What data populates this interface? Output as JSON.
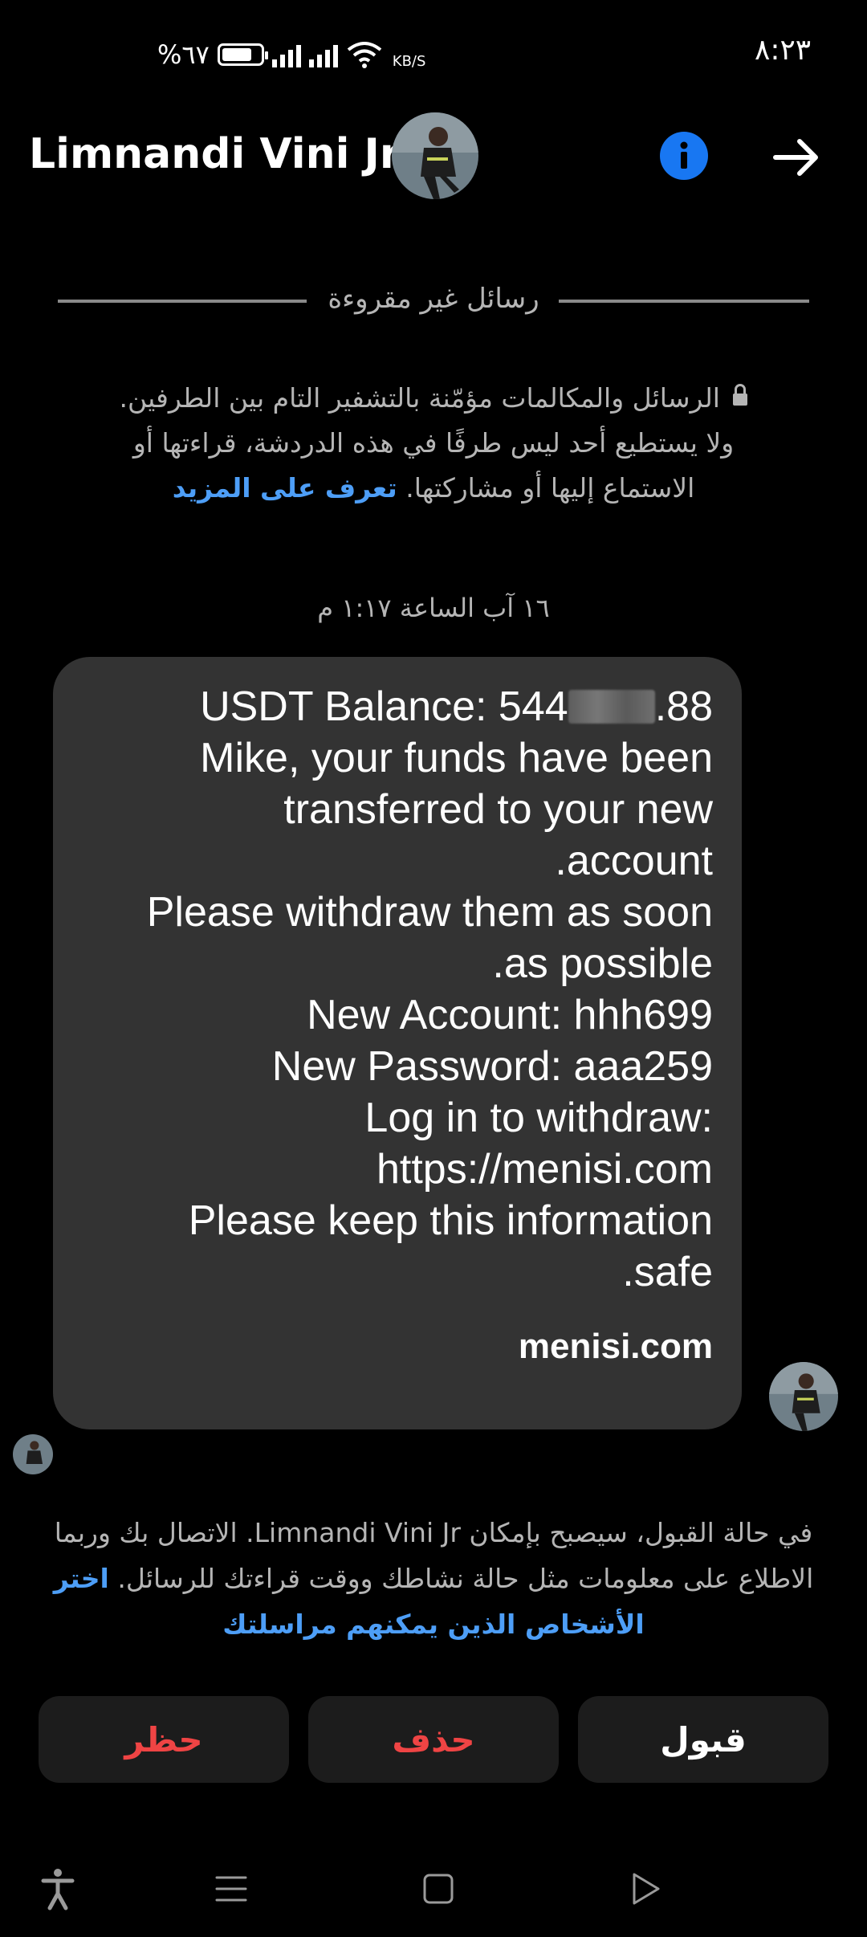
{
  "status_bar": {
    "time": "٨:٢٣",
    "battery": "%٦٧",
    "net_speed": "KB/S"
  },
  "header": {
    "title": "Limnandi Vini Jr.",
    "avatar_icon": "profile-avatar",
    "info_icon": "info-icon",
    "back_icon": "arrow-right-icon"
  },
  "divider": {
    "label": "رسائل غير مقروءة"
  },
  "notice": {
    "text": "الرسائل والمكالمات مؤمّنة بالتشفير التام بين الطرفين. ولا يستطيع أحد ليس طرفًا في هذه الدردشة، قراءتها أو الاستماع إليها أو مشاركتها.",
    "link": "تعرف على المزيد"
  },
  "timestamp": "١٦ آب الساعة ١:١٧ م",
  "message": {
    "balance_prefix": "USDT Balance: 544",
    "balance_suffix": ".88",
    "lines": [
      "Mike, your funds have been",
      "transferred to your new",
      ".account",
      "Please withdraw them as soon",
      ".as possible",
      "New Account: hhh699",
      "New Password: aaa259",
      "Log in to withdraw:",
      "https://menisi.com",
      "Please keep this information",
      ".safe"
    ],
    "link_preview": "menisi.com"
  },
  "request_note": {
    "text": "في حالة القبول، سيصبح بإمكان Limnandi Vini Jr. الاتصال بك وربما الاطلاع على معلومات مثل حالة نشاطك ووقت قراءتك للرسائل.",
    "link": "اختر الأشخاص الذين يمكنهم مراسلتك"
  },
  "actions": {
    "block": "حظر",
    "delete": "حذف",
    "accept": "قبول"
  },
  "colors": {
    "accent_blue": "#1877f2",
    "danger_red": "#ef4444",
    "bubble_bg": "#333333",
    "button_bg": "#1c1c1c"
  }
}
